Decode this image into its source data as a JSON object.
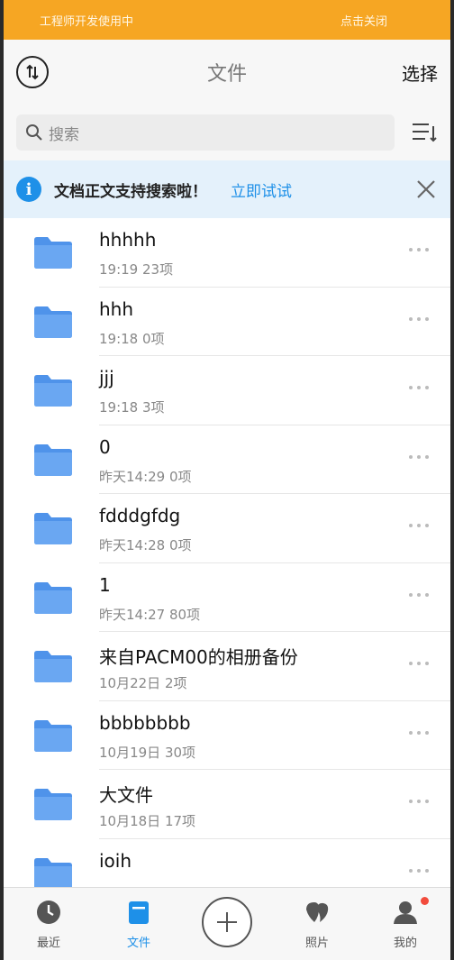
{
  "dev_banner": {
    "left_text": "工程师开发使用中",
    "right_text": "点击关闭"
  },
  "header": {
    "title": "文件",
    "select_label": "选择"
  },
  "search": {
    "placeholder": "搜索"
  },
  "tip": {
    "text": "文档正文支持搜索啦！",
    "link": "立即试试"
  },
  "files": [
    {
      "name": "hhhhh",
      "meta": "19:19  23项"
    },
    {
      "name": "hhh",
      "meta": "19:18  0项"
    },
    {
      "name": "jjj",
      "meta": "19:18  3项"
    },
    {
      "name": "0",
      "meta": "昨天14:29  0项"
    },
    {
      "name": "fdddgfdg",
      "meta": "昨天14:28  0项"
    },
    {
      "name": "1",
      "meta": "昨天14:27  80项"
    },
    {
      "name": "来自PACM00的相册备份",
      "meta": "10月22日  2项"
    },
    {
      "name": "bbbbbbbb",
      "meta": "10月19日  30项"
    },
    {
      "name": "大文件",
      "meta": "10月18日  17项"
    },
    {
      "name": "ioih",
      "meta": ""
    }
  ],
  "tabs": {
    "recent": "最近",
    "files": "文件",
    "photos": "照片",
    "mine": "我的"
  },
  "colors": {
    "accent": "#1e90e8",
    "banner": "#f6a623",
    "folder": "#5a9ef0",
    "badge": "#f24b3c"
  },
  "icons": {
    "sort": "sort-arrows-icon",
    "search": "search-icon",
    "menu": "list-sort-icon",
    "info": "info-icon",
    "close": "close-icon",
    "folder": "folder-icon",
    "more": "more-dots-icon",
    "recent": "clock-icon",
    "files": "files-icon",
    "add": "plus-icon",
    "photos": "photos-icon",
    "mine": "user-icon"
  }
}
